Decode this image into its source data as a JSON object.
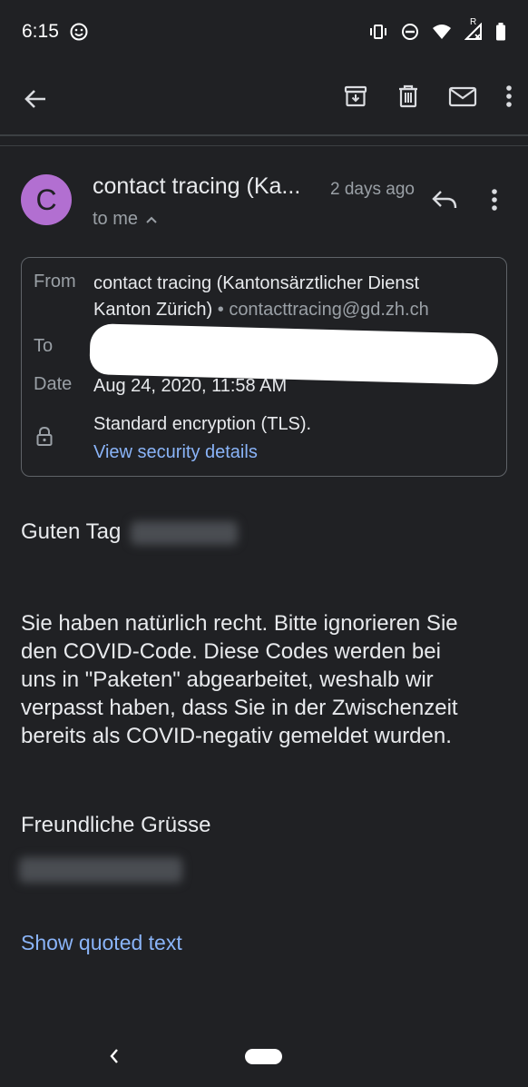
{
  "status_bar": {
    "time": "6:15",
    "icons": [
      "face-icon",
      "vibrate-icon",
      "dnd-icon",
      "wifi-icon",
      "signal-icon",
      "battery-icon"
    ],
    "roaming_label": "R"
  },
  "toolbar": {
    "icons": [
      "back-arrow-icon",
      "archive-icon",
      "delete-icon",
      "mark-unread-icon",
      "more-vert-icon"
    ]
  },
  "message": {
    "avatar_letter": "C",
    "avatar_color": "#b26fd1",
    "sender_short": "contact tracing (Ka...",
    "time_ago": "2 days ago",
    "recipient_summary": "to me"
  },
  "details": {
    "from_label": "From",
    "from_name_line1": "contact tracing (Kantonsärztlicher Dienst",
    "from_name_line2": "Kanton Zürich)",
    "separator": "•",
    "from_email": "contacttracing@gd.zh.ch",
    "to_label": "To",
    "date_label": "Date",
    "date_value": "Aug 24, 2020, 11:58 AM",
    "encryption_text": "Standard encryption (TLS).",
    "security_link": "View security details"
  },
  "body": {
    "greeting": "Guten Tag",
    "para1_line1": "Sie haben natürlich recht. Bitte ignorieren Sie",
    "para1_line2": "den COVID-Code. Diese Codes werden bei",
    "para1_line3": "uns in \"Paketen\" abgearbeitet, weshalb wir",
    "para1_line4": "verpasst haben, dass Sie in der Zwischenzeit",
    "para1_line5": "bereits als COVID-negativ gemeldet wurden.",
    "closing": "Freundliche Grüsse",
    "show_quoted": "Show quoted text"
  },
  "colors": {
    "background": "#202124",
    "link": "#8ab4f8",
    "secondary_text": "#9aa0a6"
  }
}
